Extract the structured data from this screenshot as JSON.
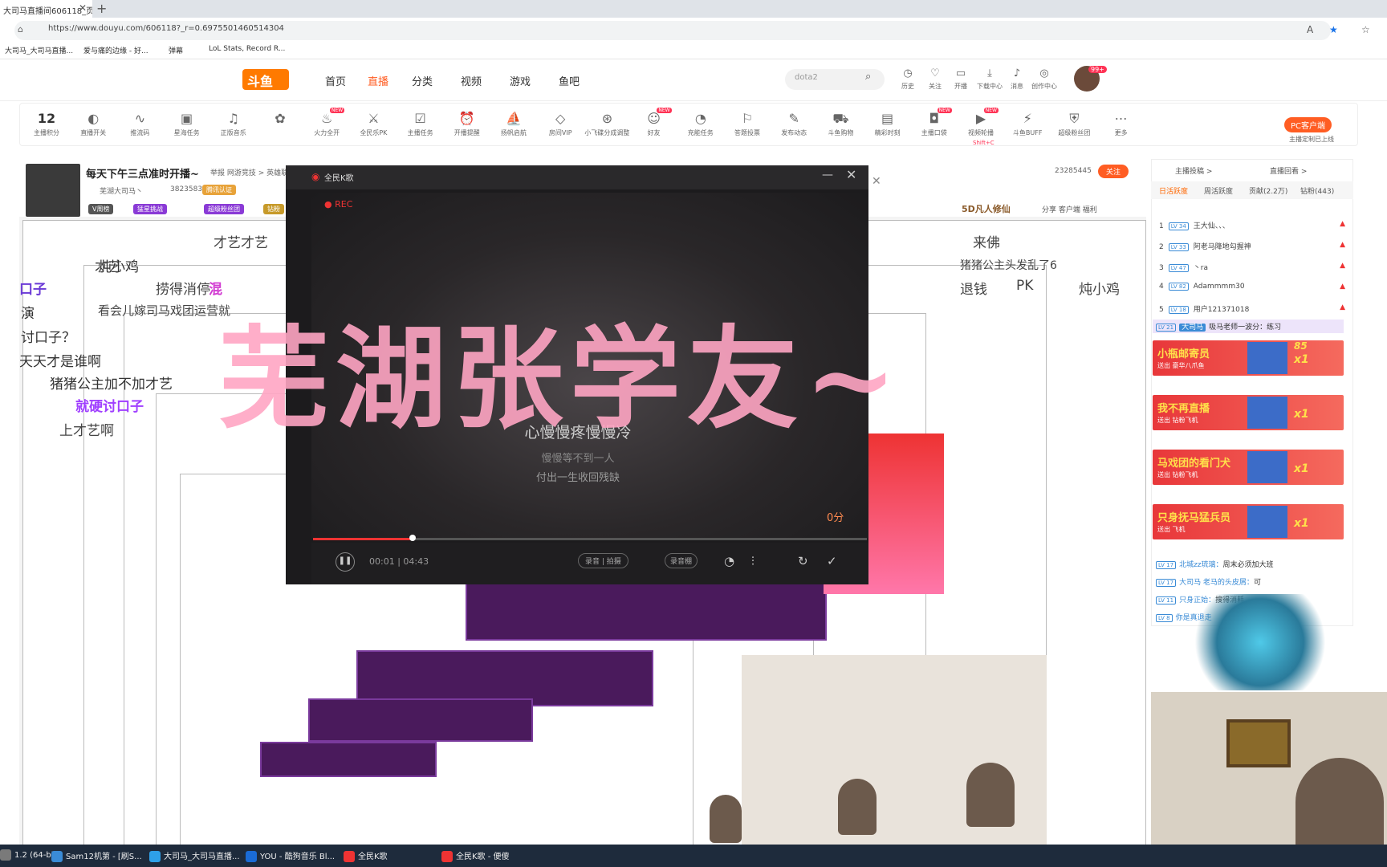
{
  "browser": {
    "tab_title": "大司马直播间606118_页",
    "url": "https://www.douyu.com/606118?_r=0.6975501460514304",
    "bookmarks": [
      "大司马_大司马直播...",
      "爱与痛的边缘 - 好...",
      "弹幕",
      "LoL Stats, Record R..."
    ]
  },
  "header": {
    "logo": "斗鱼",
    "nav": [
      "首页",
      "直播",
      "分类",
      "视频",
      "游戏",
      "鱼吧"
    ],
    "search_placeholder": "dota2",
    "icons": [
      {
        "icon": "history-icon",
        "label": "历史"
      },
      {
        "icon": "heart-icon",
        "label": "关注"
      },
      {
        "icon": "broadcast-icon",
        "label": "开播"
      },
      {
        "icon": "download-icon",
        "label": "下载中心"
      },
      {
        "icon": "bell-icon",
        "label": "消息"
      },
      {
        "icon": "bulb-icon",
        "label": "创作中心"
      }
    ],
    "avatar_badge": "99+"
  },
  "toolbar": {
    "points": "12",
    "items": [
      {
        "icon": "points-icon",
        "label": "主播积分"
      },
      {
        "icon": "toggle-icon",
        "label": "直播开关"
      },
      {
        "icon": "wave-icon",
        "label": "推流码"
      },
      {
        "icon": "ad-icon",
        "label": "星海任务"
      },
      {
        "icon": "music-icon",
        "label": "正版音乐"
      },
      {
        "icon": "gift-icon",
        "label": ""
      },
      {
        "icon": "fire-icon",
        "label": "火力全开",
        "new": "NEW"
      },
      {
        "icon": "pk-icon",
        "label": "全民乐PK"
      },
      {
        "icon": "task-icon",
        "label": "主播任务"
      },
      {
        "icon": "alarm-icon",
        "label": "开播提醒"
      },
      {
        "icon": "ship-icon",
        "label": "扬帆启航"
      },
      {
        "icon": "diamond-icon",
        "label": "房间VIP"
      },
      {
        "icon": "ufo-icon",
        "label": "小飞碟分成调整"
      },
      {
        "icon": "friends-icon",
        "label": "好友",
        "new": "NEW"
      },
      {
        "icon": "gauge-icon",
        "label": "充能任务"
      },
      {
        "icon": "vote-icon",
        "label": "答题投票"
      },
      {
        "icon": "edit-icon",
        "label": "发布动态"
      },
      {
        "icon": "cart-icon",
        "label": "斗鱼购物"
      },
      {
        "icon": "record-icon",
        "label": "精彩时刻"
      },
      {
        "icon": "bag-icon",
        "label": "主播口袋",
        "new": "NEW"
      },
      {
        "icon": "video-icon",
        "label": "视频轮播",
        "new": "NEW"
      },
      {
        "icon": "buff-icon",
        "label": "斗鱼BUFF"
      },
      {
        "icon": "shield-icon",
        "label": "超级粉丝团"
      },
      {
        "icon": "more-icon",
        "label": "更多"
      }
    ],
    "record_hint": "Shift+C",
    "pc_client": "PC客户端",
    "pc_client_sub": "主播定制已上线"
  },
  "streamer": {
    "title": "每天下午三点准时开播~",
    "report": "举报  网游竞技 > 英雄联盟",
    "name": "芜湖大司马丶",
    "hot": "3823583",
    "tags": [
      "腾讯认证",
      "V周榜",
      "猛星挑战",
      "超级粉丝团",
      "钻粉"
    ],
    "followers": "23285445",
    "follow_btn": "关注",
    "actions": "分享  客户端  福利",
    "sponsor": "5D凡人修仙"
  },
  "ksong": {
    "title": "全民K歌",
    "rec": "REC",
    "lyric1": "心慢慢疼慢慢冷",
    "lyric2": "慢慢等不到一人",
    "lyric3": "付出一生收回残缺",
    "score": "0分",
    "time": "00:01 | 04:43",
    "record_toggle": "录音 | 拍摄",
    "record_shed": "录音棚",
    "progress": 0.18
  },
  "overlay_text": "芜湖张学友~",
  "danmaku": [
    {
      "text": "上才艺",
      "color": "#ffffff"
    },
    {
      "text": "才艺",
      "color": "#ffffff"
    },
    {
      "text": "捞得消停",
      "color": "#ffffff"
    },
    {
      "text": "混",
      "color": "#d23cd2"
    },
    {
      "text": "来佛",
      "color": "#ffffff"
    },
    {
      "text": "退钱",
      "color": "#ffffff"
    },
    {
      "text": "PK",
      "color": "#ffffff"
    },
    {
      "text": "炖小鸡",
      "color": "#ffffff"
    },
    {
      "text": "小瓶邮寄员",
      "color": "#ff3a3a"
    },
    {
      "text": "猪猪公主头发乱了6",
      "color": "#ffffff"
    },
    {
      "text": "就硬讨口子",
      "color": "#a040ff"
    },
    {
      "text": "天天才是谁啊",
      "color": "#ffffff"
    },
    {
      "text": "猪猪公主加不加才艺",
      "color": "#ffffff"
    },
    {
      "text": "上才艺啊",
      "color": "#ffffff"
    },
    {
      "text": "看会儿嫁司马戏团运营就",
      "color": "#ffffff"
    },
    {
      "text": "才艺",
      "color": "#ffffff"
    },
    {
      "text": "PK",
      "color": "#ffffff"
    },
    {
      "text": "才艺才艺",
      "color": "#ffffff"
    },
    {
      "text": "讨口子？",
      "color": "#ffffff"
    },
    {
      "text": "演",
      "color": "#ffffff"
    },
    {
      "text": "口子",
      "color": "#ffffff"
    },
    {
      "text": "炖小鸡",
      "color": "#ffffff"
    }
  ],
  "right_panel": {
    "top_tabs": [
      "主播投稿 >",
      "直播回看 >"
    ],
    "tabs": [
      "日活跃度",
      "周活跃度",
      "贡献(2.2万)",
      "钻粉(443)"
    ],
    "ranking": [
      {
        "rank": "1",
        "level": "LV 34",
        "name": "王大仙、、、"
      },
      {
        "rank": "2",
        "level": "LV 33",
        "name": "阿老马降地勾握神"
      },
      {
        "rank": "3",
        "level": "LV 47",
        "name": "丶ra"
      },
      {
        "rank": "4",
        "level": "LV 82",
        "name": "Adammmm30"
      },
      {
        "rank": "5",
        "level": "LV 18",
        "name": "用户121371018"
      }
    ],
    "chat_top": {
      "level": "LV 21",
      "tag": "大司马",
      "text": "吸马老师一波分：练习"
    },
    "gifts": [
      {
        "title": "小瓶邮寄员",
        "sub": "送出 豪华八爪鱼",
        "count": "x1",
        "combo": "85"
      },
      {
        "title": "我不再直播",
        "sub": "送出 钻粉飞机",
        "count": "x1"
      },
      {
        "title": "马戏团的看门犬",
        "sub": "送出 钻粉飞机",
        "count": "x1"
      },
      {
        "title": "只身抚马猛兵员",
        "sub": "送出 飞机",
        "count": "x1"
      }
    ],
    "chats": [
      {
        "level": "LV 17",
        "name": "北城zz琉璃：",
        "text": "周末必须加大班"
      },
      {
        "level": "LV 17",
        "name": "大司马 老马的头皮屑：",
        "text": "可"
      },
      {
        "level": "LV 11",
        "name": "只身正始：",
        "text": "搜得消耗"
      },
      {
        "level": "LV 8",
        "name": "你是真退走",
        "text": ""
      }
    ]
  },
  "taskbar": [
    {
      "label": "1.2 (64-bi...",
      "color": "#7a7a7a"
    },
    {
      "label": "Sam12机第 - [刷S...",
      "color": "#3a8bd6"
    },
    {
      "label": "大司马_大司马直播...",
      "color": "#2ea0e8"
    },
    {
      "label": "YOU - 酷狗音乐 Bl...",
      "color": "#1a6bd6"
    },
    {
      "label": "全民K歌",
      "color": "#e33"
    },
    {
      "label": "全民K歌 - 便傻",
      "color": "#e33"
    }
  ]
}
